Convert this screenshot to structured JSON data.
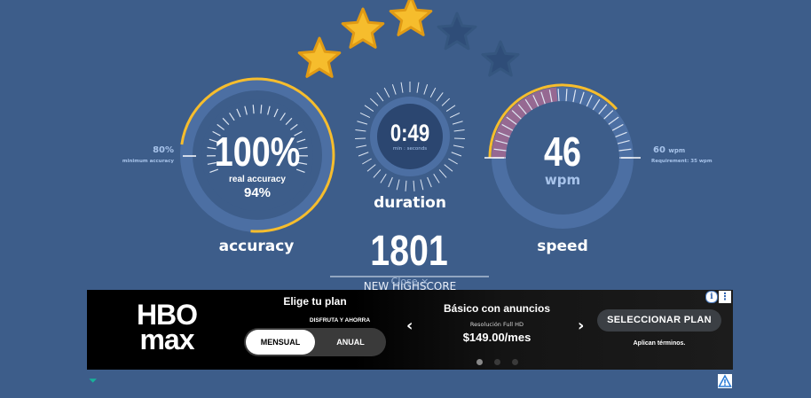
{
  "rating": {
    "stars_filled": 3,
    "stars_total": 5
  },
  "accuracy": {
    "value": "100%",
    "sub_label": "real accuracy",
    "sub_value": "94%",
    "label": "accuracy",
    "min_value": "80%",
    "min_label": "minimum accuracy",
    "fill_fraction": 1.0
  },
  "duration": {
    "value": "0:49",
    "unit": "min : seconds",
    "label": "duration"
  },
  "speed": {
    "value": "46",
    "unit": "wpm",
    "label": "speed",
    "req_value": "60",
    "req_unit": "wpm",
    "req_label": "Requirement: 35 wpm"
  },
  "score": {
    "value": "1801",
    "caption": "NEW HIGHSCORE",
    "close_label": "Close"
  },
  "ad": {
    "brand_top": "HBO",
    "brand_bottom": "max",
    "title": "Elige tu plan",
    "subtitle": "DISFRUTA Y AHORRA",
    "toggle_active": "MENSUAL",
    "toggle_inactive": "ANUAL",
    "plan_name": "Básico con anuncios",
    "plan_detail": "Resolución Full HD",
    "plan_price": "$149.00/mes",
    "cta": "SELECCIONAR PLAN",
    "terms": "Aplican términos.",
    "info_icon": "info-icon",
    "menu_icon": "kebab-menu-icon",
    "dots_total": 3,
    "dots_active": 1
  },
  "colors": {
    "background": "#3d5d8a",
    "gold": "#f6bd2d",
    "gauge_ring": "#4c6fa3",
    "gauge_dark": "#2b4670",
    "speed_band": "#a3698f",
    "label_blue": "#a7c3ea"
  }
}
